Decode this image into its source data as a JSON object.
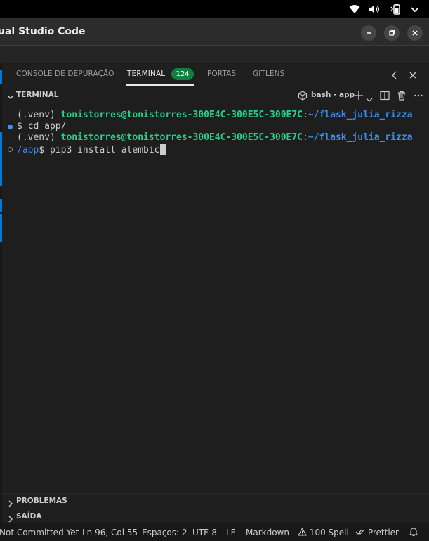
{
  "window": {
    "title": "ual Studio Code"
  },
  "system_tray": {
    "icons": [
      "wifi-icon",
      "volume-icon",
      "battery-icon",
      "chevron-down-icon"
    ]
  },
  "panel": {
    "tabs": [
      {
        "label": "CONSOLE DE DEPURAÇÃO"
      },
      {
        "label": "TERMINAL",
        "badge": "124"
      },
      {
        "label": "PORTAS"
      },
      {
        "label": "GITLENS"
      }
    ]
  },
  "terminal_header": {
    "title": "TERMINAL",
    "shell": "bash - app"
  },
  "terminal": {
    "lines": [
      {
        "prefix": "(.venv) ",
        "user": "tonistorres@tonistorres-300E4C-300E5C-300E7C",
        "sep": ":",
        "path": "~/flask_julia_rizza"
      },
      {
        "text": "$ cd app/"
      },
      {
        "prefix": "(.venv) ",
        "user": "tonistorres@tonistorres-300E4C-300E5C-300E7C",
        "sep": ":",
        "path": "~/flask_julia_rizza"
      },
      {
        "path": "/app",
        "text": "$ pip3 install alembic"
      }
    ]
  },
  "sections": {
    "problems": "PROBLEMAS",
    "output": "SAÍDA"
  },
  "statusbar": {
    "blame": "Not Committed Yet",
    "position": "Ln 96, Col 55",
    "indent": "Espaços: 2",
    "encoding": "UTF-8",
    "eol": "LF",
    "language": "Markdown",
    "spell": "100 Spell",
    "prettier": "Prettier"
  },
  "colors": {
    "accent": "#0078d4",
    "badge": "#10803e",
    "user": "#23d18b",
    "path": "#3b8eea"
  }
}
